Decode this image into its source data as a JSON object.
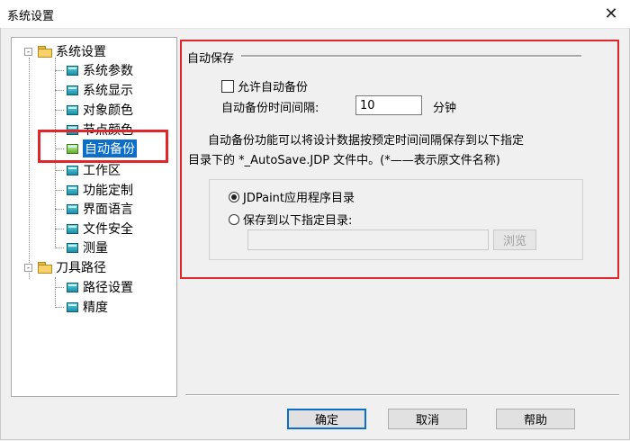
{
  "window": {
    "title": "系统设置"
  },
  "tree": {
    "groups": [
      {
        "label": "系统设置",
        "expander": "-",
        "items": [
          "系统参数",
          "系统显示",
          "对象颜色",
          "节点颜色",
          "自动备份",
          "工作区",
          "功能定制",
          "界面语言",
          "文件安全",
          "测量"
        ]
      },
      {
        "label": "刀具路径",
        "expander": "-",
        "items": [
          "路径设置",
          "精度"
        ]
      }
    ],
    "selected": "自动备份"
  },
  "panel": {
    "group_title": "自动保存",
    "allow_backup_label": "允许自动备份",
    "allow_backup_checked": false,
    "interval_label": "自动备份时间间隔:",
    "interval_value": "10",
    "interval_unit": "分钟",
    "description_line1": "自动备份功能可以将设计数据按预定时间间隔保存到以下指定",
    "description_line2": "目录下的 *_AutoSave.JDP 文件中。(*——表示原文件名称)",
    "radio_app_dir": "JDPaint应用程序目录",
    "radio_custom_dir": "保存到以下指定目录:",
    "selected_radio": "app_dir",
    "custom_dir_value": "",
    "browse_label": "浏览"
  },
  "buttons": {
    "ok": "确定",
    "cancel": "取消",
    "help": "帮助"
  },
  "colors": {
    "highlight": "#e0262b",
    "selection": "#0b6fc9"
  }
}
